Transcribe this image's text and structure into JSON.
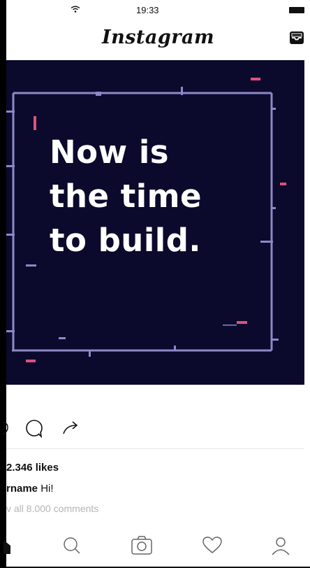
{
  "status": {
    "time": "19:33"
  },
  "header": {
    "app_title": "Instagram"
  },
  "post": {
    "headline_lines": [
      "Now is",
      "the time",
      "to build."
    ],
    "likes": "2.346 likes",
    "caption_user": "rname",
    "caption_text": " Hi!",
    "comments_link": "v all 8.000 comments"
  },
  "colors": {
    "post_background": "#0b0a2c",
    "frame": "#8d88c8",
    "accent": "#e0507a"
  },
  "icons": {
    "actions": [
      "heart-icon",
      "comment-icon",
      "share-icon"
    ],
    "tabs": [
      "home-icon",
      "search-icon",
      "camera-icon",
      "activity-heart-icon",
      "profile-icon"
    ]
  }
}
